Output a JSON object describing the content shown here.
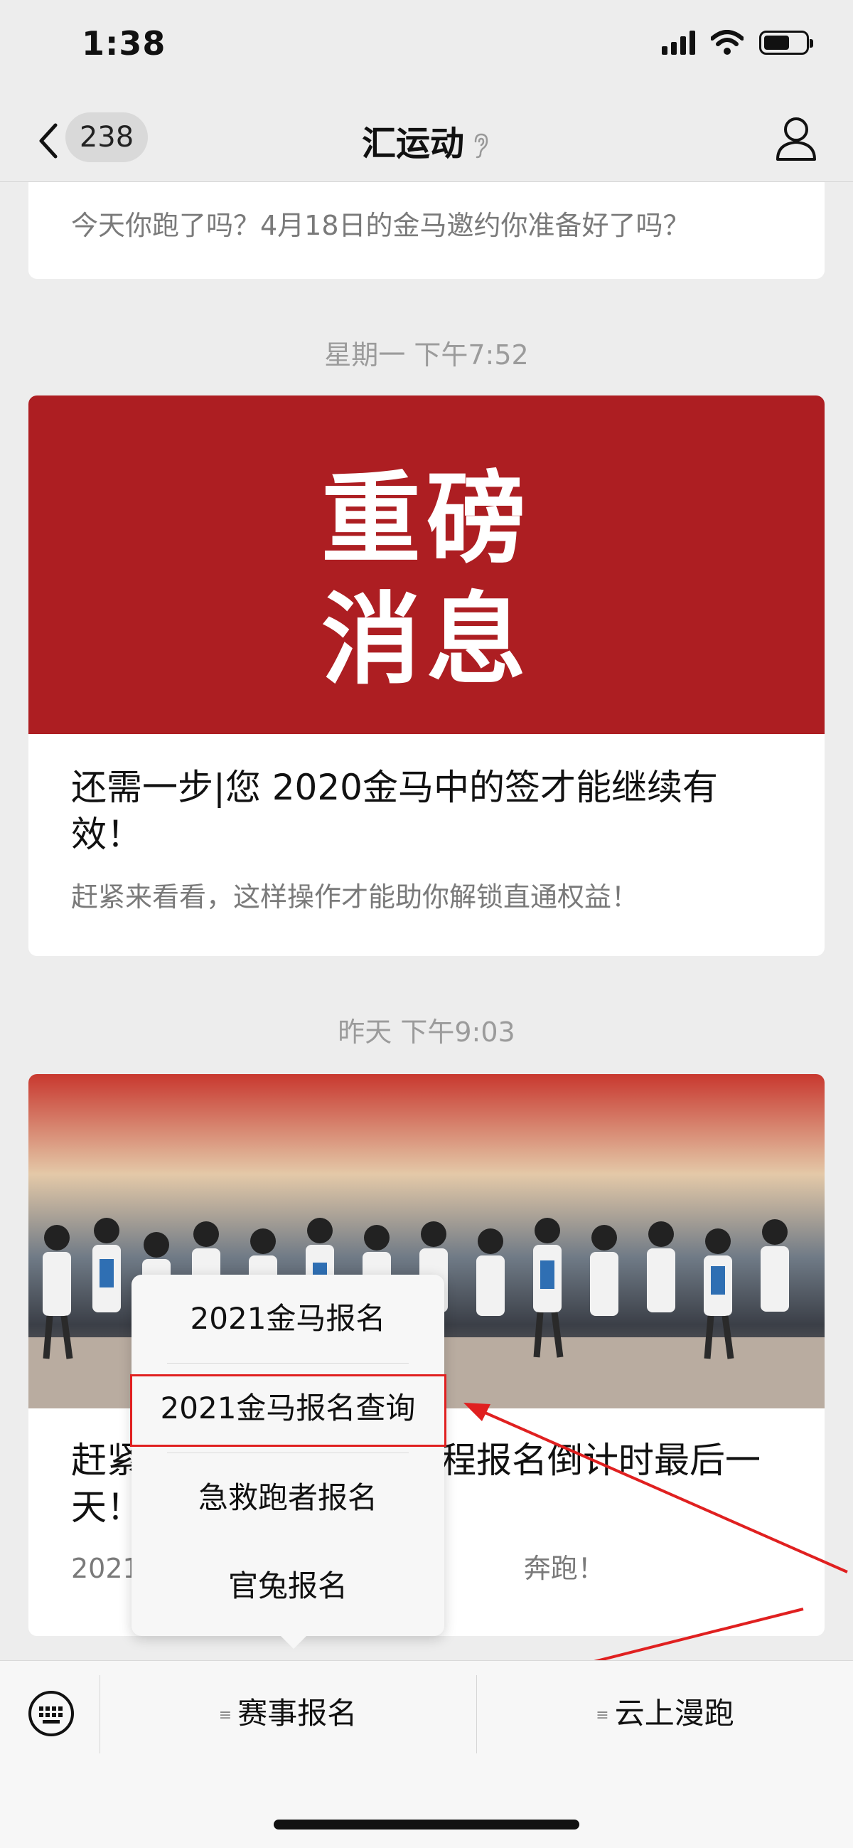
{
  "status_bar": {
    "time": "1:38"
  },
  "nav": {
    "unread_count": "238",
    "title": "汇运动"
  },
  "feed": {
    "prev_summary": "今天你跑了吗？4月18日的金马邀约你准备好了吗？",
    "messages": [
      {
        "timestamp": "星期一 下午7:52",
        "banner_line1": "重磅",
        "banner_line2": "消息",
        "title": "还需一步|您 2020金马中的签才能继续有效！",
        "summary": "赶紧来看看，这样操作才能助你解锁直通权益！"
      },
      {
        "timestamp": "昨天 下午9:03",
        "title_left": "赶紧",
        "title_right": "程报名倒计时最后一",
        "title_line2": "天！",
        "summary_left": "2021",
        "summary_right": "奔跑！"
      }
    ]
  },
  "popup_menu": {
    "items": [
      "2021金马报名",
      "2021金马报名查询",
      "急救跑者报名",
      "官兔报名"
    ]
  },
  "bottom_menu": {
    "items": [
      "赛事报名",
      "云上漫跑"
    ]
  },
  "colors": {
    "annotation_red": "#e02020",
    "banner_red": "#ad1e22"
  }
}
